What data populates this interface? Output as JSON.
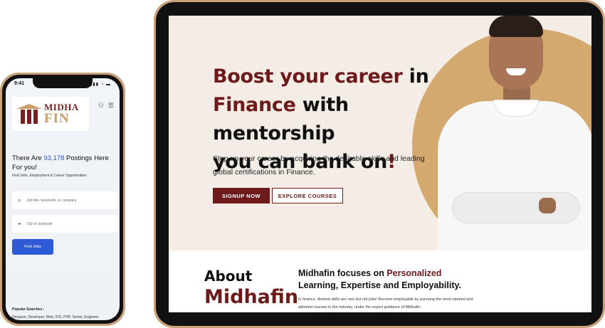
{
  "phone": {
    "time": "9:41",
    "status": "▮▮▮ ◔ ▬",
    "logo": {
      "top": "MIDHA",
      "bottom": "FIN",
      "tm": "TM"
    },
    "heading_pre": "There Are ",
    "heading_num": "93,178",
    "heading_post": " Postings Here For you!",
    "subheading": "Find Jobs, Employment & Career Opportunities",
    "search_placeholder": "Job title, keywords, or company",
    "location_placeholder": "City or postcode",
    "find_button": "Find Jobs",
    "popular_label": "Popular Searches :",
    "popular_list": "Designer, Developer, Web, IOS, PHP, Senior, Engineer",
    "icons": {
      "user": "user-icon",
      "menu": "menu-icon",
      "search": "search-icon",
      "location": "location-pin-icon"
    }
  },
  "tablet": {
    "hero": {
      "line1_a": "Boost your career",
      "line1_b": " in",
      "line2_a": "Finance",
      "line2_b": " with mentorship",
      "line3_a": "you can bank on",
      "line3_b": "!",
      "subtitle": "Step up your career by acquiring the desirable skills and leading global certifications in Finance.",
      "signup": "SIGNUP NOW",
      "explore": "EXPLORE COURSES"
    },
    "about": {
      "label": "About",
      "name": "Midhafin",
      "head_a": "Midhafin focuses on ",
      "head_hl": "Personalized",
      "head_b": " Learning, Expertise and Employability.",
      "text": "In finance, desired skills are rare but not jobs! Become employable by pursuing the most reputed and admired courses in the industry, under the expert guidance of Midhafin."
    }
  },
  "colors": {
    "maroon": "#6e1a1a",
    "gold": "#d4a96f",
    "blue": "#2f5ad6",
    "cream": "#f3ede6"
  }
}
